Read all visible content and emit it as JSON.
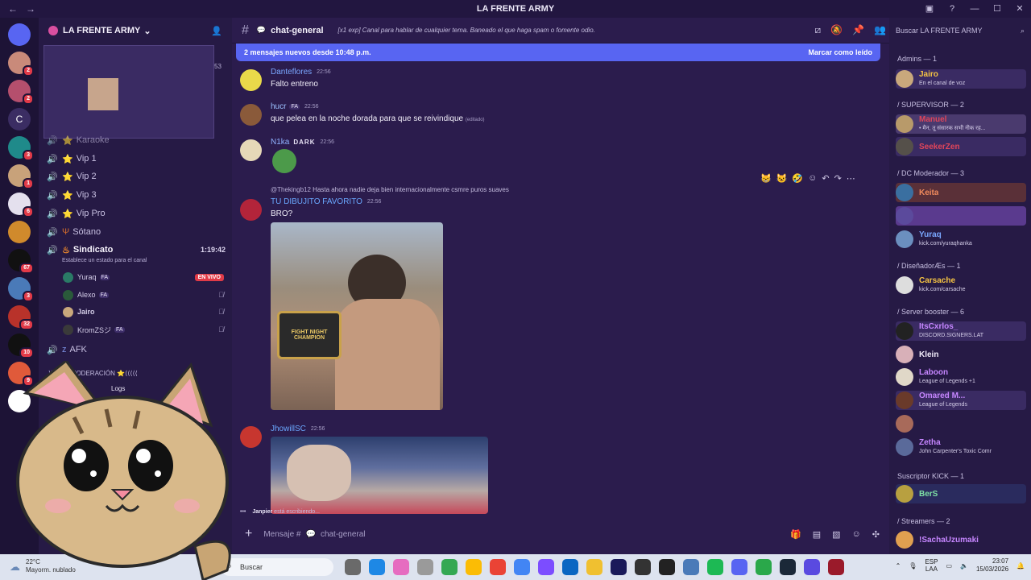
{
  "window": {
    "title": "LA FRENTE ARMY"
  },
  "server": {
    "name": "LA FRENTE ARMY",
    "stream_count": "53"
  },
  "guild_badges": [
    "2",
    "2",
    "3",
    "1",
    "6",
    "67",
    "3",
    "32",
    "10",
    "9"
  ],
  "channels": {
    "partial": "Karaoke",
    "list": [
      {
        "label": "Vip 1"
      },
      {
        "label": "Vip 2"
      },
      {
        "label": "Vip 3"
      },
      {
        "label": "Vip Pro"
      },
      {
        "label": "Sótano"
      }
    ],
    "sindicato": {
      "label": "Sindicato",
      "time": "1:19:42",
      "status_hint": "Establece un estado para el canal",
      "live_badge": "EN VIVO"
    },
    "voice_users": [
      {
        "name": "Yuraq",
        "tag": "FA"
      },
      {
        "name": "Alexo",
        "tag": "FA"
      },
      {
        "name": "Jairo",
        "tag": ""
      },
      {
        "name": "KromZSジ",
        "tag": "FA"
      }
    ],
    "afk": "AFK",
    "category": "⟩⟩⟩⟩⟩ ⭐MODERACIÓN ⭐⟨⟨⟨⟨⟨",
    "sub": "Logs"
  },
  "chat": {
    "channel_name": "chat-general",
    "topic": "[x1 exp] Canal para hablar de cualquier tema. Baneado el que haga spam o fomente odio.",
    "new_messages_text": "2 mensajes nuevos desde 10:48 p.m.",
    "mark_read": "Marcar como leído",
    "messages": [
      {
        "author": "Danteflores",
        "time": "22:56",
        "text": "Falto entreno",
        "tag": ""
      },
      {
        "author": "hucr",
        "time": "22:56",
        "text": "que pelea en la noche dorada  para que se reivindique",
        "edited": "(editado)",
        "tag": "FA"
      },
      {
        "author": "N1ka",
        "time": "22:56",
        "text": "",
        "tag": "DARK"
      },
      {
        "author": "TU DIBUJITO FAVORITO",
        "time": "22:56",
        "text": "BRO?",
        "tag": ""
      },
      {
        "author": "JhowillSC",
        "time": "22:56",
        "text": "",
        "tag": ""
      }
    ],
    "reply": {
      "author": "@Thekingb12",
      "text": "Hasta ahora nadie deja bien internacionalmente csmre puros suaves"
    },
    "image_caption": "FIGHT NIGHT CHAMPION",
    "typing_user": "Janpier",
    "typing_suffix": "está escribiendo...",
    "composer_placeholder": "Mensaje #",
    "composer_channel": "chat-general"
  },
  "members": {
    "search_placeholder": "Buscar LA FRENTE ARMY",
    "groups": [
      {
        "label": "Admins — 1"
      },
      {
        "label": "/ SUPERVISOR — 2"
      },
      {
        "label": "/ DC Moderador — 3"
      },
      {
        "label": "/ DiseñadorÆs — 1"
      },
      {
        "label": "/ Server booster — 6"
      },
      {
        "label": "Suscriptor KICK — 1"
      },
      {
        "label": "/ Streamers — 2"
      }
    ],
    "list": [
      {
        "name": "Jairo",
        "status": "En el canal de voz",
        "color": "#f6c443"
      },
      {
        "name": "Manuel",
        "status": "• मैन, तू संसारक सभी नीक रह...",
        "color": "#e0455a"
      },
      {
        "name": "SeekerZen",
        "status": "",
        "color": "#e0455a"
      },
      {
        "name": "Keita",
        "status": "",
        "color": "#f08a5d"
      },
      {
        "name": "",
        "status": "",
        "color": "#a87cf0"
      },
      {
        "name": "Yuraq",
        "status": "kick.com/yuraqhanka",
        "color": "#7aa7ff"
      },
      {
        "name": "Carsache",
        "status": "kick.com/carsache",
        "color": "#f6c443"
      },
      {
        "name": "ItsCxrlos_",
        "status": "DISCORD.SIGNERS.LAT",
        "color": "#c686ff"
      },
      {
        "name": "Klein",
        "status": "",
        "color": "#f3eefc"
      },
      {
        "name": "Laboon",
        "status": "League of Legends +1",
        "color": "#c686ff"
      },
      {
        "name": "Omared M...",
        "status": "League of Legends",
        "color": "#c686ff"
      },
      {
        "name": "",
        "status": "",
        "color": "#c686ff"
      },
      {
        "name": "Zetha",
        "status": "John Carpenter's Toxic Comr",
        "color": "#c686ff"
      },
      {
        "name": "BerS",
        "status": "",
        "color": "#7ee0a5"
      },
      {
        "name": "!SachaUzumaki",
        "status": "",
        "color": "#c686ff"
      }
    ]
  },
  "taskbar": {
    "weather_temp": "22°C",
    "weather_desc": "Mayorm. nublado",
    "search_label": "Buscar",
    "lang": "ESP",
    "lang_sub": "LAA",
    "time": "23:07",
    "date": "15/03/2026"
  }
}
